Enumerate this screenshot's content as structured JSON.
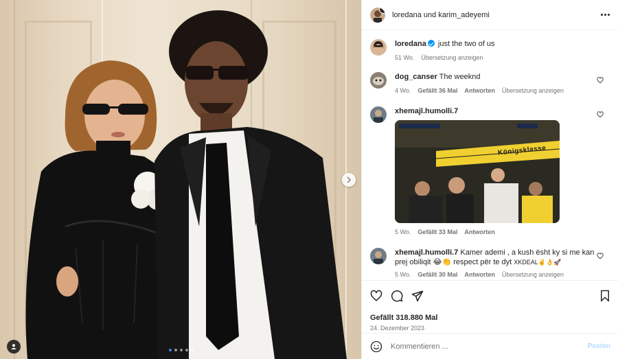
{
  "post": {
    "header_author": "loredana und karim_adeyemi",
    "caption": {
      "username": "loredana",
      "verified": true,
      "text": "just the two of us",
      "time": "51 Wo.",
      "translate": "Übersetzung anzeigen"
    },
    "likes": "Gefällt 318.880 Mal",
    "date": "24. Dezember 2023"
  },
  "comments": [
    {
      "username": "dog_canser",
      "text": "The weeknd",
      "time": "4 Wo.",
      "likes": "Gefällt 36 Mal",
      "reply": "Antworten",
      "translate": "Übersetzung anzeigen"
    },
    {
      "username": "xhemajl.humolli.7",
      "text": "",
      "gif_banner": "Königsklasse",
      "time": "5 Wo.",
      "likes": "Gefällt 33 Mal",
      "reply": "Antworten"
    },
    {
      "username": "xhemajl.humolli.7",
      "text": "Kamer ademi , a kush ësht ky si me kan prej obiliqit 😂👏 respect për te dyt",
      "text_suffix": "XKDEAL✌️👌🚀",
      "time": "5 Wo.",
      "likes": "Gefällt 30 Mal",
      "reply": "Antworten",
      "translate": "Übersetzung anzeigen"
    }
  ],
  "composer": {
    "placeholder": "Kommentieren ...",
    "post_label": "Posten"
  },
  "carousel": {
    "slide_count": 5,
    "active_index": 0
  },
  "icons": {
    "like": "heart-icon",
    "comment": "comment-icon",
    "share": "share-icon",
    "save": "bookmark-icon",
    "emoji": "emoji-icon",
    "more": "more-options-icon",
    "next": "chevron-right-icon",
    "tags": "user-tag-icon"
  },
  "colors": {
    "link_blue": "#0095f6",
    "post_disabled": "#b3dbff",
    "muted_text": "#737373"
  }
}
